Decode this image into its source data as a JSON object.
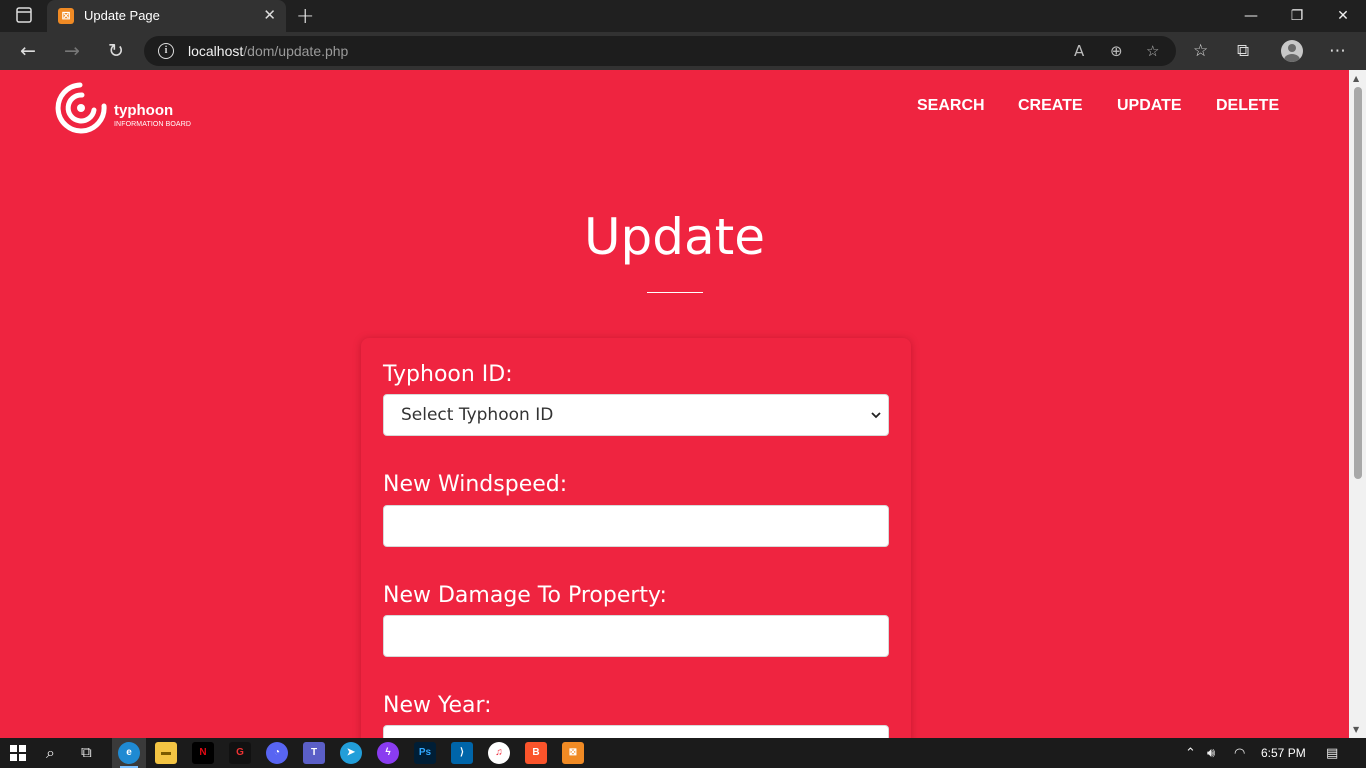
{
  "browser": {
    "tab_title": "Update Page",
    "tab_favicon": "xampp-icon",
    "url_host": "localhost",
    "url_path": "/dom/update.php"
  },
  "site": {
    "logo_name": "typhoon",
    "logo_sub": "INFORMATION BOARD",
    "nav": [
      "SEARCH",
      "CREATE",
      "UPDATE",
      "DELETE"
    ],
    "accent": "#ef2440"
  },
  "page": {
    "title": "Update"
  },
  "form": {
    "id_label": "Typhoon ID:",
    "id_select_value": "Select Typhoon ID",
    "windspeed_label": "New Windspeed:",
    "windspeed_value": "",
    "damage_label": "New Damage To Property:",
    "damage_value": "",
    "year_label": "New Year:"
  },
  "taskbar": {
    "clock": "6:57 PM"
  }
}
